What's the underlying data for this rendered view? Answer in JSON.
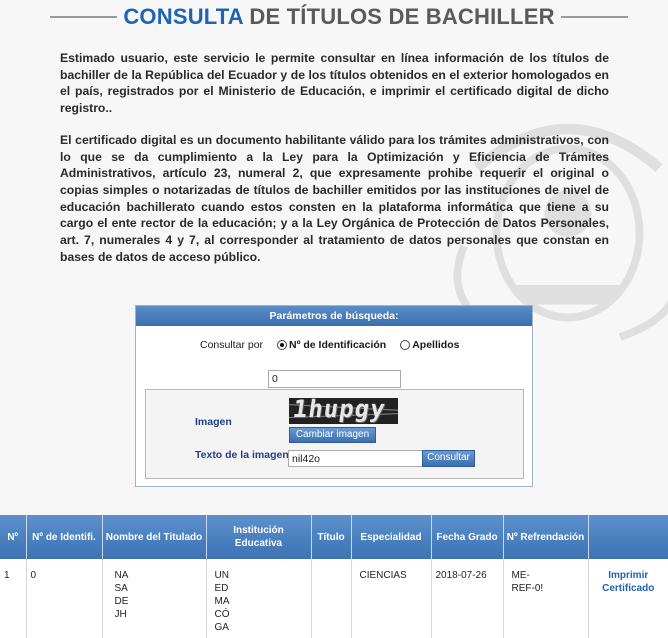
{
  "title": {
    "highlight": "CONSULTA",
    "rest": "DE TÍTULOS DE BACHILLER"
  },
  "intro": {
    "p1": "Estimado usuario, este servicio le permite consultar en línea información de los títulos de bachiller de la República del Ecuador y de los títulos obtenidos en el exterior homologados en el país, registrados por el Ministerio de Educación, e imprimir el certificado digital de dicho registro..",
    "p2": "El certificado digital es un documento habilitante válido para los trámites administrativos, con lo que se da cumplimiento a la Ley para la Optimización y Eficiencia de Trámites Administrativos, artículo 23, numeral 2, que expresamente prohibe requerir el original o copias simples o notarizadas de títulos de bachiller emitidos por las instituciones de nivel de educación bachillerato cuando estos consten en la plataforma informática que tiene a su cargo el ente rector de la educación; y a la Ley Orgánica de Protección de Datos Personales, art. 7, numerales 4 y 7, al corresponder al tratamiento de datos personales que constan en bases de datos de acceso público."
  },
  "search": {
    "header": "Parámetros de búsqueda:",
    "consult_label": "Consultar por",
    "option_id": "Nº de Identificación",
    "option_apellidos": "Apellidos",
    "selected": "id",
    "id_value": "0",
    "imagen_label": "Imagen",
    "captcha_text": "1hupgy",
    "cambiar_button": "Cambiar imagen",
    "texto_label": "Texto de la imagen:",
    "texto_value": "nil42o",
    "consultar_button": "Consultar"
  },
  "table": {
    "headers": [
      "Nº",
      "Nº de Identifi.",
      "Nombre del Titulado",
      "Institución Educativa",
      "Título",
      "Especialidad",
      "Fecha Grado",
      "Nº Refrendación",
      ""
    ],
    "rows": [
      {
        "n": "1",
        "id": "0",
        "nombre": "NA\nSA\nDE\nJH",
        "institucion": "UN\nED\nMA\nCÓ\nGA",
        "titulo": "",
        "especialidad": "CIENCIAS",
        "fecha": "2018-07-26",
        "refrendacion": "ME-\nREF-0!",
        "accion": "Imprimir Certificado"
      }
    ]
  },
  "colors": {
    "accent": "#1f63b5",
    "header_blue": "#3d72b4"
  }
}
